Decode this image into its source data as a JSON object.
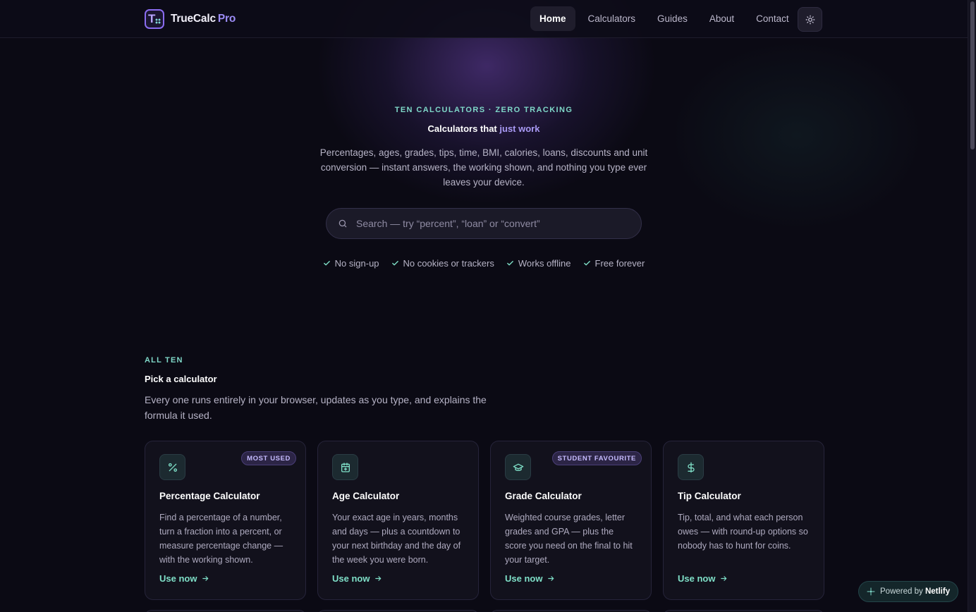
{
  "header": {
    "brand_name": "TrueCalc",
    "brand_suffix": "Pro",
    "logo_letter": "T",
    "nav": [
      {
        "label": "Home",
        "active": true
      },
      {
        "label": "Calculators",
        "active": false
      },
      {
        "label": "Guides",
        "active": false
      },
      {
        "label": "About",
        "active": false
      },
      {
        "label": "Contact",
        "active": false
      }
    ],
    "theme_toggle_icon": "sun-icon"
  },
  "hero": {
    "eyebrow": "TEN CALCULATORS · ZERO TRACKING",
    "title_lead": "Calculators that",
    "title_accent": "just work",
    "description": "Percentages, ages, grades, tips, time, BMI, calories, loans, discounts and unit conversion — instant answers, the working shown, and nothing you type ever leaves your device.",
    "search_placeholder": "Search — try “percent”, “loan” or “convert”",
    "search_value": "",
    "perks": [
      "No sign-up",
      "No cookies or trackers",
      "Works offline",
      "Free forever"
    ]
  },
  "section": {
    "eyebrow": "ALL TEN",
    "title": "Pick a calculator",
    "description": "Every one runs entirely in your browser, updates as you type, and explains the formula it used."
  },
  "cards": [
    {
      "icon": "percent-icon",
      "badge": "MOST USED",
      "title": "Percentage Calculator",
      "description": "Find a percentage of a number, turn a fraction into a percent, or measure percentage change — with the working shown.",
      "link": "Use now"
    },
    {
      "icon": "calendar-icon",
      "badge": "",
      "title": "Age Calculator",
      "description": "Your exact age in years, months and days — plus a countdown to your next birthday and the day of the week you were born.",
      "link": "Use now"
    },
    {
      "icon": "graduation-cap-icon",
      "badge": "STUDENT FAVOURITE",
      "title": "Grade Calculator",
      "description": "Weighted course grades, letter grades and GPA — plus the score you need on the final to hit your target.",
      "link": "Use now"
    },
    {
      "icon": "dollar-icon",
      "badge": "",
      "title": "Tip Calculator",
      "description": "Tip, total, and what each person owes — with round-up options so nobody has to hunt for coins.",
      "link": "Use now"
    }
  ],
  "netlify": {
    "prefix": "Powered by",
    "brand": "Netlify"
  },
  "colors": {
    "background": "#0b0a14",
    "accent_purple": "#9c8cf5",
    "accent_teal": "#7fd8c8"
  }
}
